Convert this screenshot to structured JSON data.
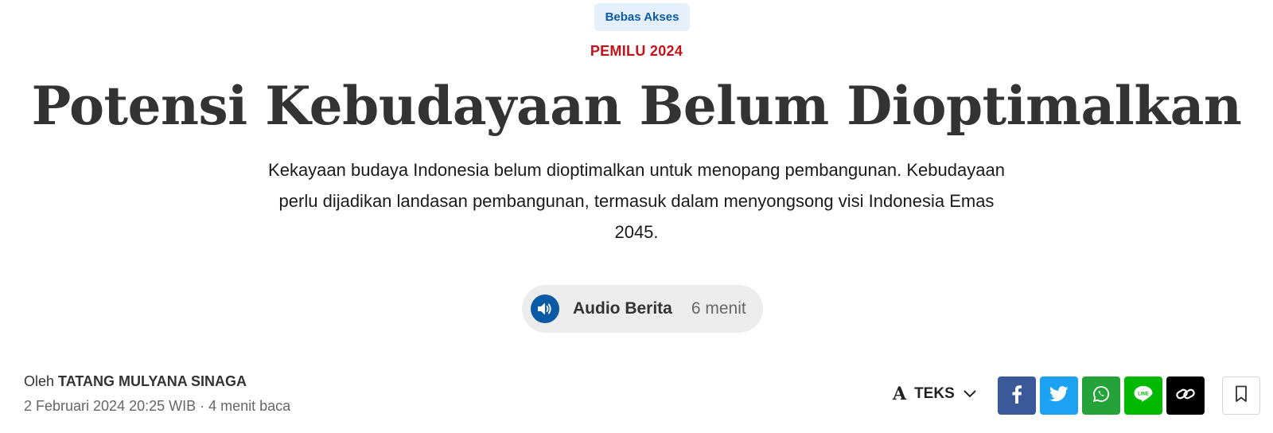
{
  "badge": {
    "label": "Bebas Akses"
  },
  "category": {
    "label": "PEMILU 2024"
  },
  "article": {
    "title": "Potensi Kebudayaan Belum Dioptimalkan",
    "summary": "Kekayaan budaya Indonesia belum dioptimalkan untuk menopang pembangunan. Kebudayaan perlu dijadikan landasan pembangunan, termasuk dalam menyongsong visi Indonesia Emas 2045."
  },
  "audio": {
    "label": "Audio Berita",
    "duration": "6 menit",
    "icon": "speaker-icon"
  },
  "byline": {
    "prefix": "Oleh",
    "author": "TATANG MULYANA SINAGA",
    "meta": "2 Februari 2024 20:25 WIB · 4 menit baca"
  },
  "text_size": {
    "glyph": "A",
    "label": "TEKS"
  },
  "share": [
    {
      "name": "facebook",
      "color": "#3b5998"
    },
    {
      "name": "twitter",
      "color": "#1da1f2"
    },
    {
      "name": "whatsapp",
      "color": "#25a33a"
    },
    {
      "name": "line",
      "color": "#00b900",
      "text": "LINE"
    },
    {
      "name": "copy-link",
      "color": "#000000"
    }
  ],
  "colors": {
    "brand_blue": "#0b5aa6",
    "category_red": "#c4121a",
    "badge_bg": "#e6f0fa"
  }
}
